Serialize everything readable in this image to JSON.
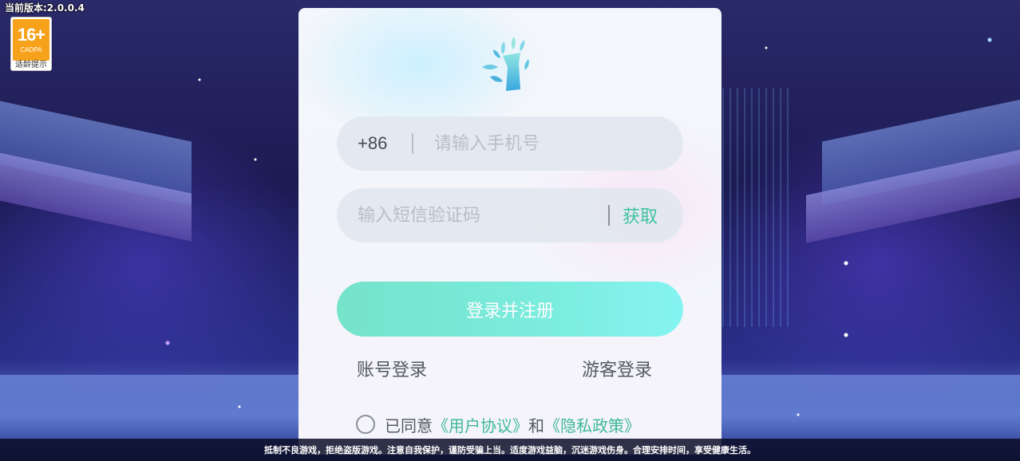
{
  "version_label": "当前版本:2.0.0.4",
  "age_rating": {
    "number": "16+",
    "org": "CADPA",
    "tip": "适龄提示",
    "color": "#f7a21b"
  },
  "login": {
    "logo_icon": "leaf-logo-icon",
    "phone": {
      "country_code": "+86",
      "placeholder": "请输入手机号",
      "value": ""
    },
    "code": {
      "placeholder": "输入短信验证码",
      "value": "",
      "get_code_label": "获取"
    },
    "submit_label": "登录并注册",
    "account_login_label": "账号登录",
    "guest_login_label": "游客登录",
    "agreement": {
      "prefix": "已同意",
      "user_agreement": "《用户协议》",
      "connector": "和",
      "privacy_policy": "《隐私政策》",
      "checked": false
    },
    "accent_color": "#3fc3a0"
  },
  "footer_text": "抵制不良游戏，拒绝盗版游戏。注意自我保护，谨防受骗上当。适度游戏益脑，沉迷游戏伤身。合理安排时间，享受健康生活。"
}
